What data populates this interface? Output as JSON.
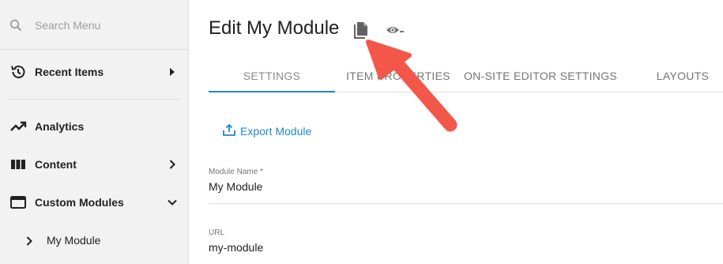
{
  "sidebar": {
    "search": {
      "placeholder": "Search Menu",
      "value": ""
    },
    "items": [
      {
        "label": "Recent Items",
        "icon": "history-icon",
        "chevron": "right"
      },
      {
        "label": "Analytics",
        "icon": "trending-up-icon"
      },
      {
        "label": "Content",
        "icon": "columns-icon",
        "chevron": "right"
      },
      {
        "label": "Custom Modules",
        "icon": "web-window-icon",
        "chevron": "down"
      }
    ],
    "sub_items": [
      {
        "label": "My Module",
        "chevron": "right"
      }
    ]
  },
  "main": {
    "title": "Edit My Module",
    "title_icons": [
      "copy-document-icon",
      "preview-eye-icon"
    ],
    "tabs": [
      {
        "label": "SETTINGS",
        "active": true
      },
      {
        "label": "ITEM PROPERTIES"
      },
      {
        "label": "ON-SITE EDITOR SETTINGS"
      },
      {
        "label": "LAYOUTS"
      }
    ],
    "export_label": "Export Module",
    "fields": [
      {
        "label": "Module Name *",
        "value": "My Module"
      },
      {
        "label": "URL",
        "value": "my-module"
      }
    ]
  },
  "colors": {
    "accent": "#1e88c8",
    "arrow": "#f2574a",
    "sidebar_bg": "#f2f2f2"
  }
}
